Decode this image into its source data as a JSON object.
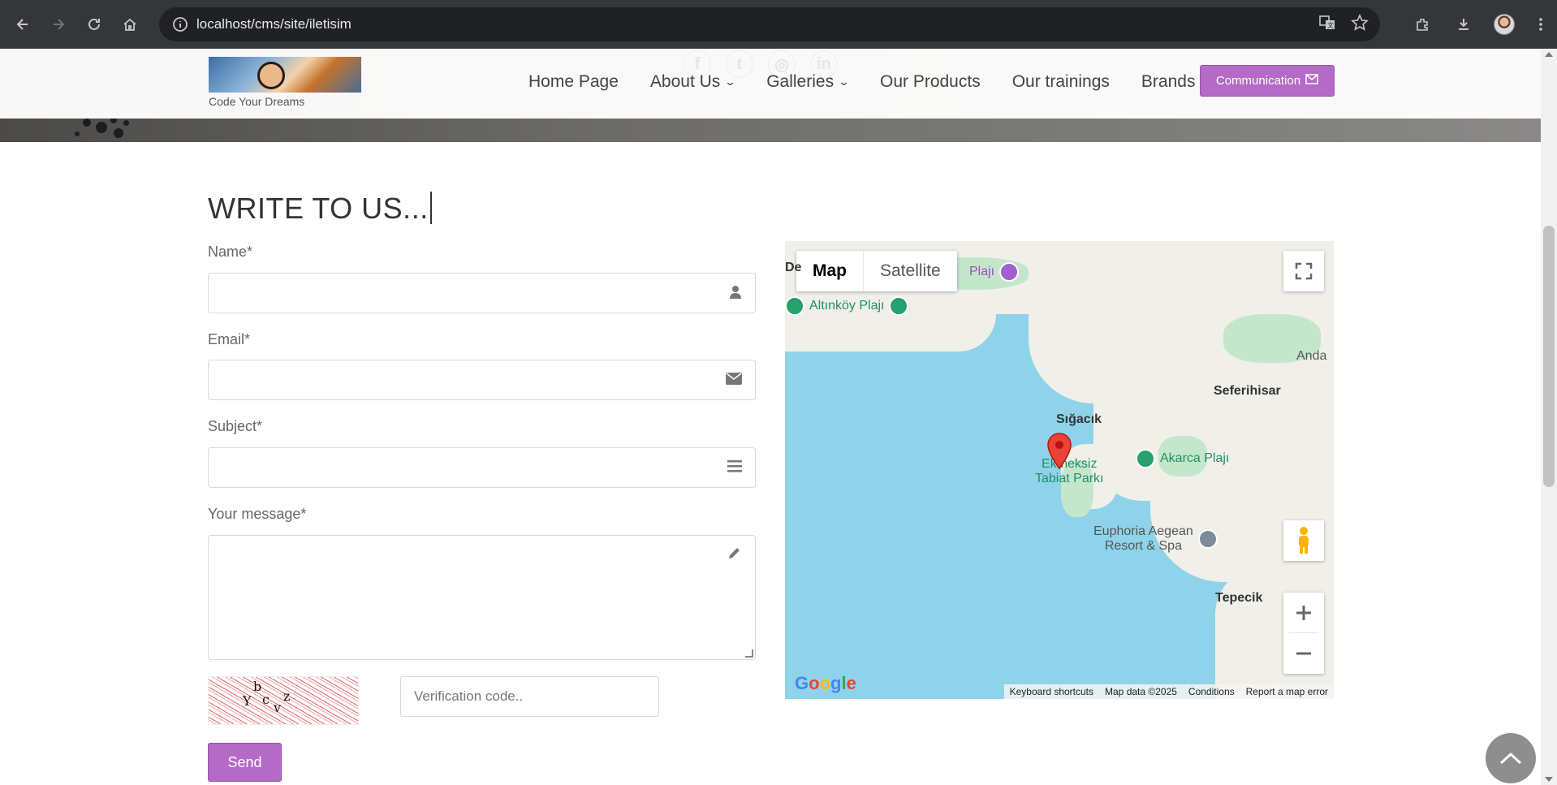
{
  "browser": {
    "url": "localhost/cms/site/iletisim",
    "icons": [
      "back-icon",
      "forward-icon",
      "reload-icon",
      "home-icon",
      "site-info-icon",
      "translate-icon",
      "star-icon",
      "extensions-icon",
      "download-icon",
      "profile-avatar"
    ]
  },
  "header": {
    "tagline": "Code Your Dreams",
    "social_icons": [
      "facebook-icon",
      "twitter-icon",
      "instagram-icon",
      "linkedin-icon"
    ],
    "menu": {
      "home": "Home Page",
      "about": "About Us",
      "galleries": "Galleries",
      "products": "Our Products",
      "trainings": "Our trainings",
      "brands": "Brands"
    },
    "communication_label": "Communication",
    "accent_color": "#b46ac6"
  },
  "form": {
    "title": "WRITE TO US...",
    "name_label": "Name*",
    "name_value": "",
    "email_label": "Email*",
    "email_value": "",
    "subject_label": "Subject*",
    "subject_value": "",
    "message_label": "Your message*",
    "message_value": "",
    "captcha_chars": [
      "b",
      "Y",
      "c",
      "v",
      "z"
    ],
    "verification_placeholder": "Verification code..",
    "send_label": "Send"
  },
  "map": {
    "type_map": "Map",
    "type_satellite": "Satellite",
    "places": {
      "seferihisar": "Seferihisar",
      "sigacik": "Sığacık",
      "tepecik": "Tepecik",
      "anda": "Anda",
      "de": "De"
    },
    "pois": {
      "plaji": "Plajı",
      "altinkoy": "Altınköy Plajı",
      "ekmeksiz_1": "Ekmeksiz",
      "ekmeksiz_2": "Tabiat Parkı",
      "akarca": "Akarca Plajı",
      "euphoria_1": "Euphoria Aegean",
      "euphoria_2": "Resort & Spa"
    },
    "google": "Google",
    "attribution": {
      "shortcuts": "Keyboard shortcuts",
      "data": "Map data ©2025",
      "conditions": "Conditions",
      "report": "Report a map error"
    }
  }
}
